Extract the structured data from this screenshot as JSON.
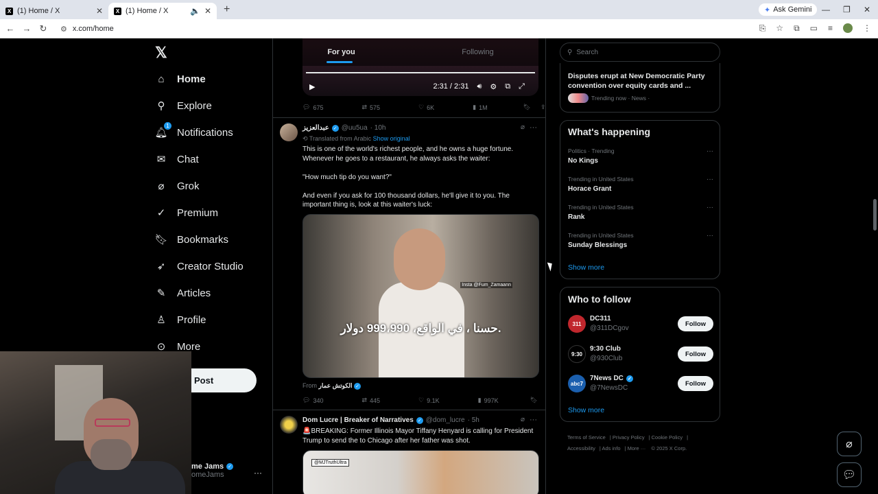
{
  "browser": {
    "tabs": [
      {
        "title": "(1) Home / X",
        "active": false
      },
      {
        "title": "(1) Home / X",
        "active": true
      }
    ],
    "new_tab": "+",
    "gemini_label": "Ask Gemini",
    "url": "x.com/home"
  },
  "nav": {
    "logo": "𝕏",
    "notification_badge": "1",
    "items": [
      {
        "label": "Home",
        "icon": "home-icon"
      },
      {
        "label": "Explore",
        "icon": "search-icon"
      },
      {
        "label": "Notifications",
        "icon": "bell-icon"
      },
      {
        "label": "Chat",
        "icon": "mail-icon"
      },
      {
        "label": "Grok",
        "icon": "grok-icon"
      },
      {
        "label": "Premium",
        "icon": "verified-icon"
      },
      {
        "label": "Bookmarks",
        "icon": "bookmark-icon"
      },
      {
        "label": "Creator Studio",
        "icon": "rocket-icon"
      },
      {
        "label": "Articles",
        "icon": "article-icon"
      },
      {
        "label": "Profile",
        "icon": "person-icon"
      },
      {
        "label": "More",
        "icon": "more-circle-icon"
      }
    ],
    "post_label": "Post",
    "account": {
      "name": "me Jams",
      "handle": "omeJams",
      "more": "···"
    }
  },
  "feed": {
    "tabs": [
      "For you",
      "Following"
    ],
    "top_video": {
      "time": "2:31 / 2:31"
    },
    "top_actions": {
      "replies": "675",
      "reposts": "575",
      "likes": "6K",
      "views": "1M"
    },
    "tweet1": {
      "name": "عبدالعزيز",
      "handle": "@uu5ua",
      "time": "· 10h",
      "translated": "Translated from Arabic",
      "show_original": "Show original",
      "text": "This is one of the world's richest people, and he owns a huge fortune. Whenever he goes to a restaurant, he always asks the waiter:\n\n\"How much tip do you want?\"\n\nAnd even if you ask for 100 thousand dollars, he'll give it to you. The important thing is, look at this waiter's luck:",
      "video_subtitle": "حسنا ، في الواقع، 999،990 دولار.",
      "video_watermark": "Insta @Fum_Zamaann",
      "from_label": "From",
      "from_name": "الكوتش عمار",
      "replies": "340",
      "reposts": "445",
      "likes": "9.1K",
      "views": "997K"
    },
    "tweet2": {
      "name": "Dom Lucre | Breaker of Narratives",
      "handle": "@dom_lucre",
      "time": "· 5h",
      "text": "🚨BREAKING: Former Illinois Mayor Tiffany Henyard is calling for President Trump to send the to Chicago after her father was shot.",
      "image_watermark": "@MJTruthUltra"
    }
  },
  "sidebar": {
    "search_placeholder": "Search",
    "news": {
      "title": "Disputes erupt at New Democratic Party convention over equity cards and ...",
      "meta": "Trending now · News ·"
    },
    "whats_happening": {
      "title": "What's happening",
      "trends": [
        {
          "meta": "Politics · Trending",
          "title": "No Kings"
        },
        {
          "meta": "Trending in United States",
          "title": "Horace Grant"
        },
        {
          "meta": "Trending in United States",
          "title": "Rank"
        },
        {
          "meta": "Trending in United States",
          "title": "Sunday Blessings"
        }
      ],
      "show_more": "Show more"
    },
    "who_to_follow": {
      "title": "Who to follow",
      "accounts": [
        {
          "name": "DC311",
          "handle": "@311DCgov",
          "avatar": "311",
          "verified": false
        },
        {
          "name": "9:30 Club",
          "handle": "@930Club",
          "avatar": "9:30",
          "verified": false
        },
        {
          "name": "7News DC",
          "handle": "@7NewsDC",
          "avatar": "abc7",
          "verified": true
        }
      ],
      "follow_label": "Follow",
      "show_more": "Show more"
    },
    "footer": [
      "Terms of Service",
      "Privacy Policy",
      "Cookie Policy",
      "Accessibility",
      "Ads info",
      "More ···",
      "© 2025 X Corp."
    ]
  },
  "colors": {
    "accent": "#1d9bf0",
    "background": "#000000",
    "border": "#2f3336",
    "muted": "#71767b"
  }
}
